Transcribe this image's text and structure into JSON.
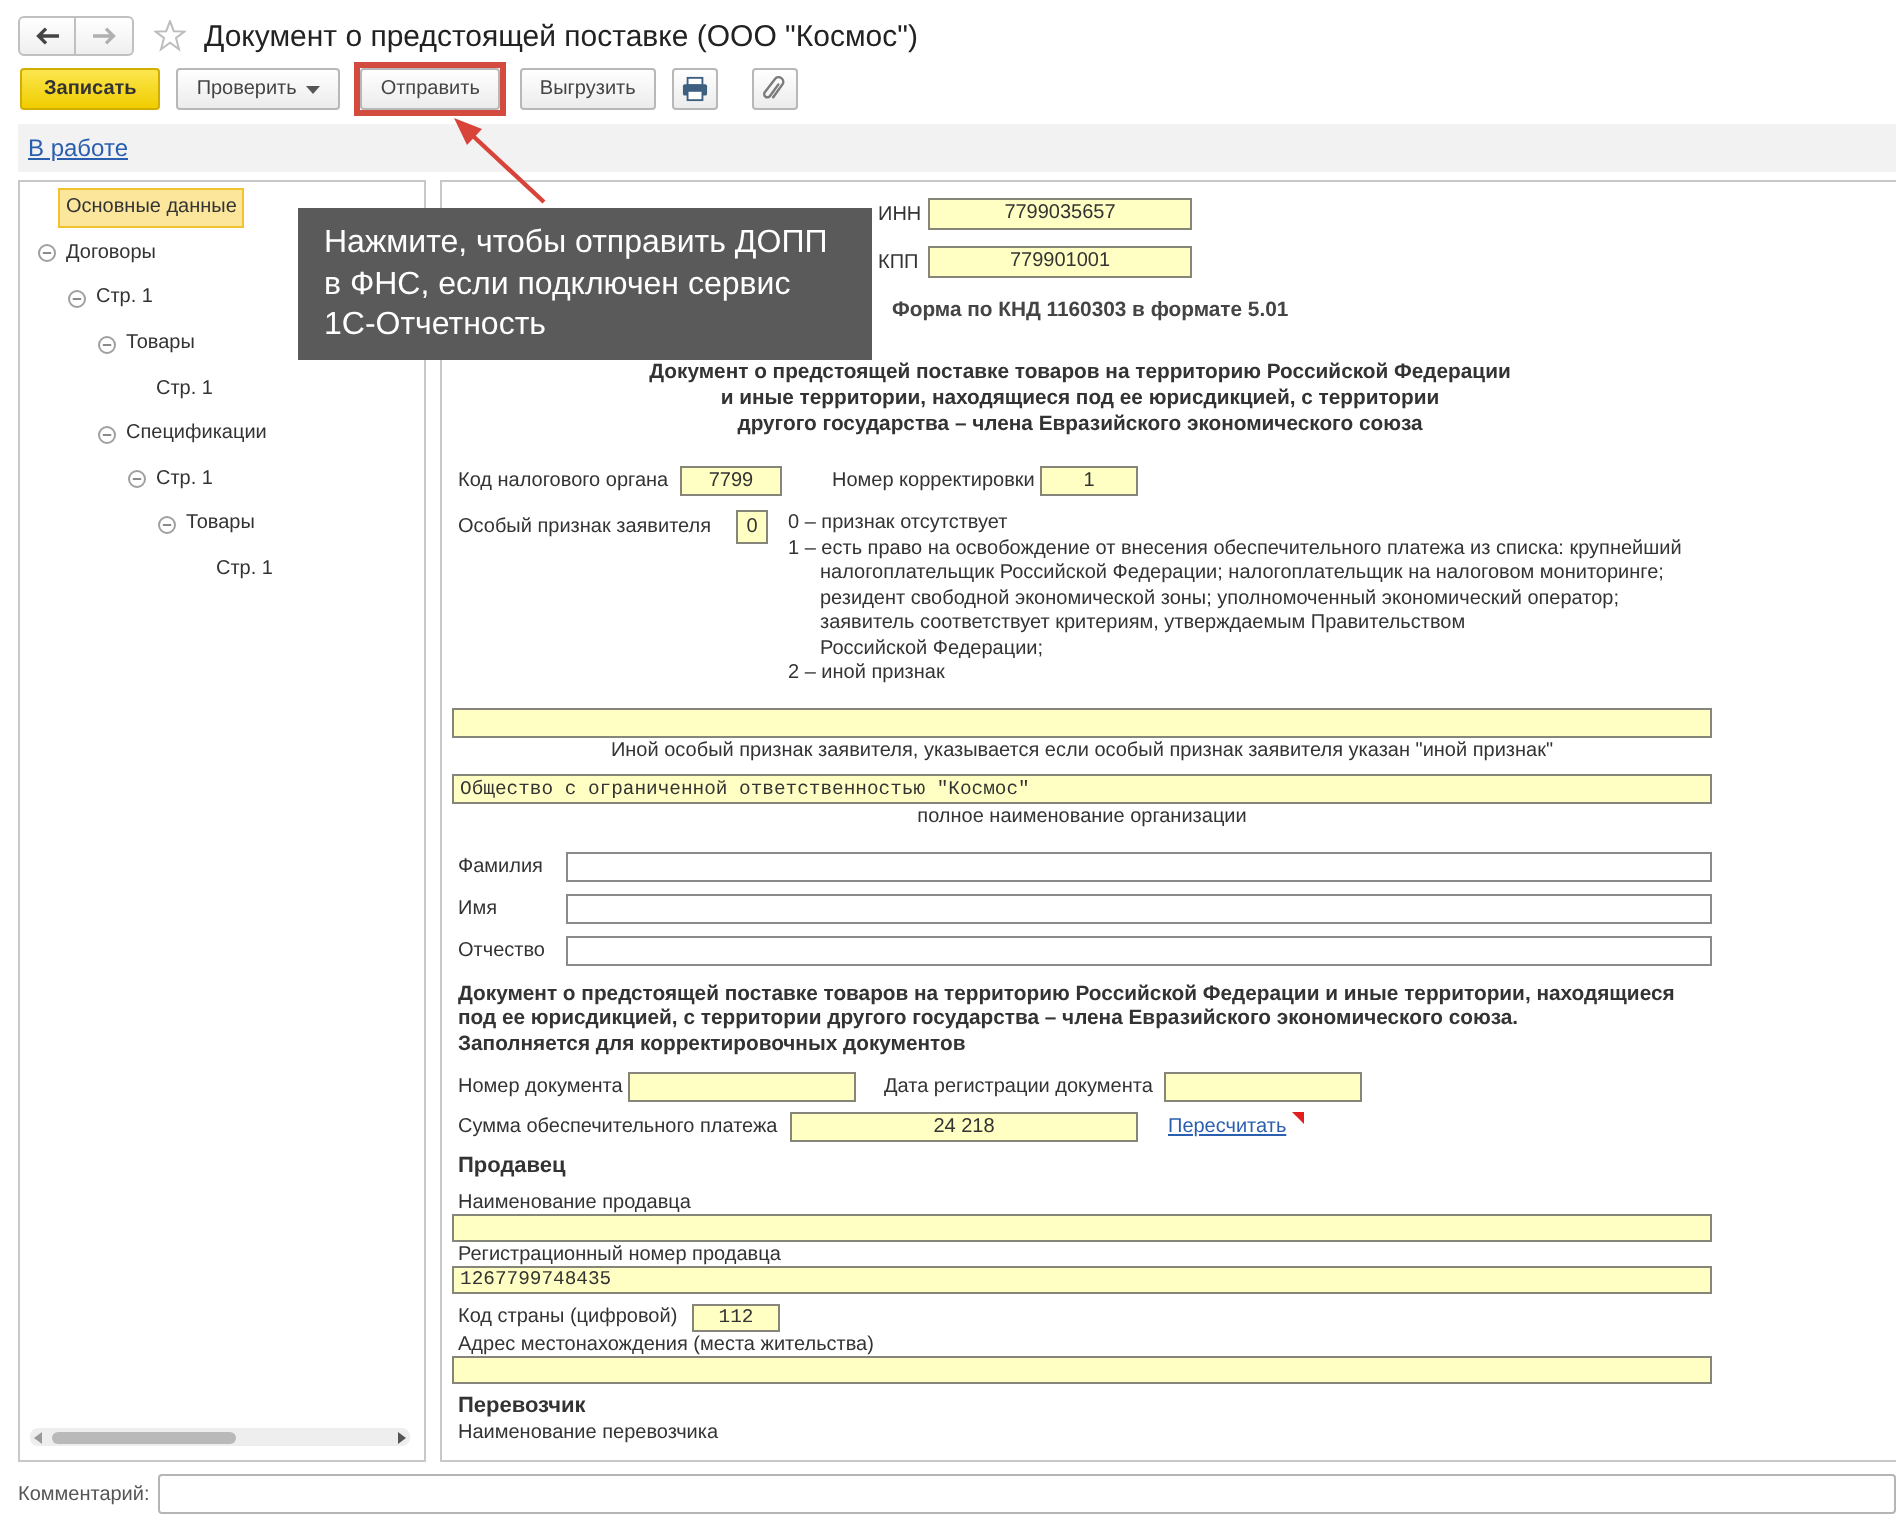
{
  "window": {
    "title": "Документ о предстоящей поставке (ООО \"Космос\")",
    "favorite": false
  },
  "navigation": {
    "back": {
      "disabled": false
    },
    "forward": {
      "disabled": true
    }
  },
  "toolbar": [
    {
      "kind": "primary",
      "label": "Записать",
      "highlighted": false
    },
    {
      "kind": "dropdown",
      "label": "Проверить",
      "highlighted": false
    },
    {
      "kind": "plain",
      "label": "Отправить",
      "highlighted": true
    },
    {
      "kind": "plain",
      "label": "Выгрузить",
      "highlighted": false
    },
    {
      "kind": "print",
      "highlighted": false
    },
    {
      "kind": "attach",
      "highlighted": false
    }
  ],
  "status_link": "В работе",
  "callout": {
    "lines": [
      "Нажмите, чтобы отправить ДОПП",
      "в ФНС, если подключен сервис",
      "1С-Отчетность"
    ]
  },
  "tree": {
    "items": [
      {
        "label": "Основные данные",
        "selected": true
      },
      {
        "label": "Договоры",
        "selected": false,
        "expanded": true,
        "children": [
          {
            "label": "Стр. 1",
            "selected": false,
            "expanded": true,
            "children": [
              {
                "label": "Товары",
                "selected": false,
                "expanded": true,
                "children": [
                  {
                    "label": "Стр. 1",
                    "selected": false
                  }
                ]
              },
              {
                "label": "Спецификации",
                "selected": false,
                "expanded": true,
                "children": [
                  {
                    "label": "Стр. 1",
                    "selected": false,
                    "expanded": true,
                    "children": [
                      {
                        "label": "Товары",
                        "selected": false,
                        "expanded": true,
                        "children": [
                          {
                            "label": "Стр. 1",
                            "selected": false
                          }
                        ]
                      }
                    ]
                  }
                ]
              }
            ]
          }
        ]
      }
    ]
  },
  "form": {
    "inn": {
      "label": "ИНН",
      "value": "7799035657"
    },
    "kpp": {
      "label": "КПП",
      "value": "779901001"
    },
    "form_code": "Форма по КНД 1160303 в формате 5.01",
    "title_lines": [
      "Документ о предстоящей поставке товаров на территорию Российской Федерации",
      "и иные территории, находящиеся под ее юрисдикцией, с территории",
      "другого государства – члена Евразийского экономического союза"
    ],
    "tax_office": {
      "label": "Код налогового органа",
      "value": "7799"
    },
    "correction_number": {
      "label": "Номер корректировки",
      "value": "1"
    },
    "applicant_sign": {
      "label": "Особый признак заявителя",
      "value": "0",
      "options": [
        {
          "lines": [
            "0 – признак отсутствует"
          ]
        },
        {
          "lines": [
            "1 – есть право на освобождение от внесения обеспечительного платежа из списка: крупнейший",
            "налогоплательщик Российской Федерации; налогоплательщик на налоговом мониторинге;",
            "резидент свободной экономической зоны; уполномоченный экономический оператор;",
            "заявитель соответствует критериям, утверждаемым Правительством",
            "Российской Федерации;"
          ]
        },
        {
          "lines": [
            "2 – иной признак"
          ]
        }
      ]
    },
    "other_sign": {
      "caption": "Иной особый признак заявителя, указывается если особый признак заявителя указан \"иной признак\""
    },
    "organization": {
      "value": "Общество с ограниченной ответственностью \"Космос\"",
      "caption": "полное наименование организации"
    },
    "person": [
      {
        "label": "Фамилия"
      },
      {
        "label": "Имя"
      },
      {
        "label": "Отчество"
      }
    ],
    "correction_section": {
      "heading": "Документ о предстоящей поставке товаров на территорию Российской Федерации и иные территории, находящиеся под ее юрисдикцией, с территории другого государства – члена Евразийского экономического союза.",
      "note": "Заполняется для корректировочных документов"
    },
    "document_number": {
      "label": "Номер документа"
    },
    "registration_date": {
      "label": "Дата регистрации документа"
    },
    "guarantee_amount": {
      "label": "Сумма обеспечительного платежа",
      "value": "24 218",
      "link": "Пересчитать"
    },
    "seller": {
      "heading": "Продавец",
      "fields": [
        {
          "kind": "wide",
          "label": "Наименование продавца"
        },
        {
          "kind": "wide",
          "label": "Регистрационный номер продавца",
          "value": "1267799748435"
        },
        {
          "kind": "inline",
          "label": "Код страны (цифровой)",
          "value": "112"
        },
        {
          "kind": "wide",
          "label": "Адрес местонахождения (места жительства)"
        }
      ]
    },
    "carrier": {
      "heading": "Перевозчик",
      "first_label": "Наименование перевозчика"
    }
  },
  "comment": {
    "label": "Комментарий:"
  }
}
